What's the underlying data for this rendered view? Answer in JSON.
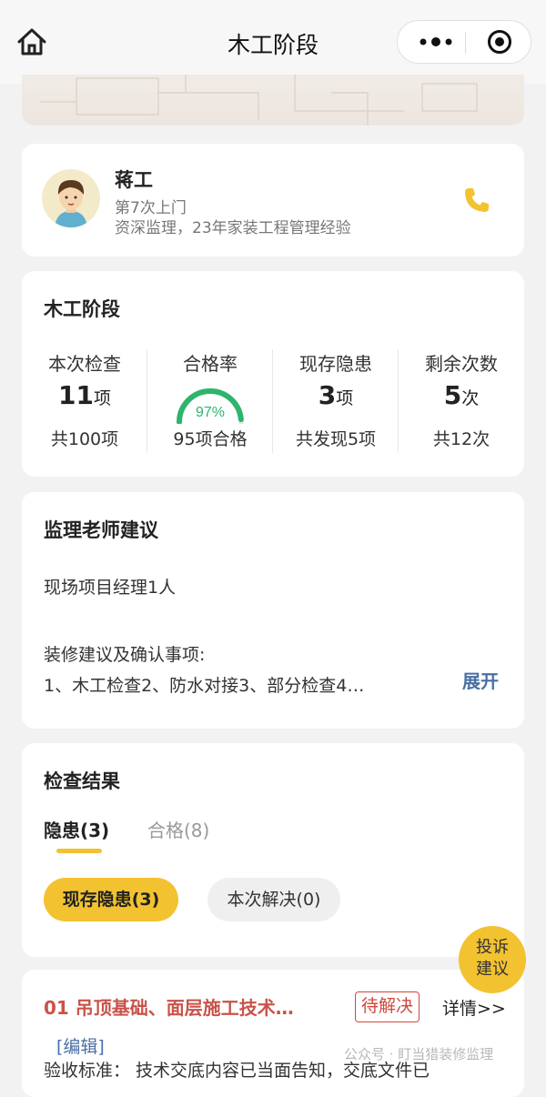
{
  "header": {
    "title": "木工阶段"
  },
  "inspector": {
    "name": "蒋工",
    "visit": "第7次上门",
    "description": "资深监理，23年家装工程管理经验"
  },
  "stage": {
    "title": "木工阶段",
    "stats": [
      {
        "label": "本次检查",
        "value": "11",
        "unit": "项",
        "sub": "共100项"
      },
      {
        "label": "合格率",
        "value": "97%",
        "sub": "95项合格"
      },
      {
        "label": "现存隐患",
        "value": "3",
        "unit": "项",
        "sub": "共发现5项"
      },
      {
        "label": "剩余次数",
        "value": "5",
        "unit": "次",
        "sub": "共12次"
      }
    ],
    "pass_rate": 0.97
  },
  "advice": {
    "title": "监理老师建议",
    "line1": "现场项目经理1人",
    "line2": "装修建议及确认事项:",
    "line3": "1、木工检查2、防水对接3、部分检查4…",
    "expand": "展开"
  },
  "results": {
    "title": "检查结果",
    "tabs": [
      {
        "label": "隐患(3)"
      },
      {
        "label": "合格(8)"
      }
    ],
    "filters": [
      {
        "label": "现存隐患(3)"
      },
      {
        "label": "本次解决(0)"
      }
    ]
  },
  "issue": {
    "title": "01 吊顶基础、面层施工技术…",
    "status": "待解决",
    "detail": "详情>>",
    "edit": "[编辑]",
    "criteria": "验收标准：  技术交底内容已当面告知，交底文件已"
  },
  "float_button": {
    "line1": "投诉",
    "line2": "建议"
  },
  "watermark": "公众号 · 盯当猎装修监理",
  "colors": {
    "accent": "#f2c230",
    "danger": "#d0473c",
    "link": "#4a6fa5",
    "gauge": "#2cb56c"
  }
}
